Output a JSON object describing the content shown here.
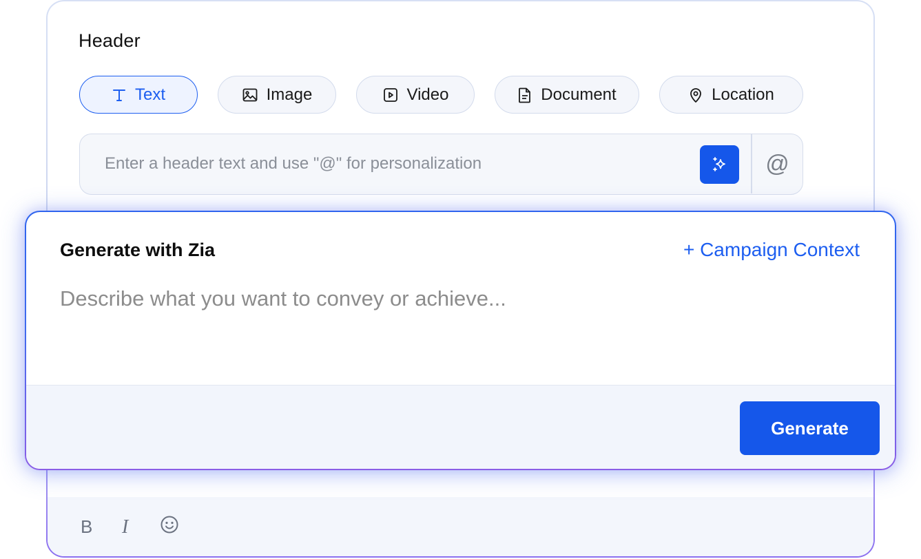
{
  "header": {
    "title": "Header",
    "types": [
      {
        "label": "Text",
        "icon": "text-icon",
        "active": true
      },
      {
        "label": "Image",
        "icon": "image-icon",
        "active": false
      },
      {
        "label": "Video",
        "icon": "video-icon",
        "active": false
      },
      {
        "label": "Document",
        "icon": "document-icon",
        "active": false
      },
      {
        "label": "Location",
        "icon": "location-icon",
        "active": false
      }
    ],
    "input_placeholder": "Enter a header text and use \"@\" for personalization",
    "input_value": "",
    "at_symbol": "@"
  },
  "zia": {
    "title": "Generate with Zia",
    "campaign_context_label": "+ Campaign Context",
    "prompt_placeholder": "Describe what you want to convey or achieve...",
    "prompt_value": "",
    "generate_label": "Generate"
  },
  "toolbar": {
    "bold_label": "B",
    "italic_label": "I"
  },
  "colors": {
    "accent": "#1557ea",
    "active_pill_text": "#1d5ef0",
    "card_border_top": "#d7e0f5",
    "card_border_bottom": "#8b6ff0"
  }
}
